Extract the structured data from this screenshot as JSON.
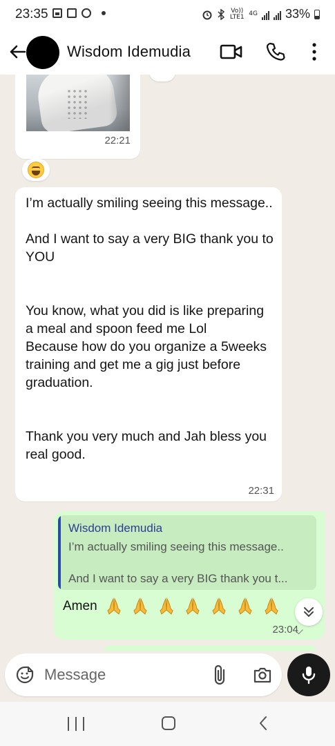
{
  "status_bar": {
    "time": "23:35",
    "network_volte": "Vo)) LTE1",
    "network_4g": "4G",
    "battery": "33%"
  },
  "header": {
    "contact_name": "Wisdom Idemudia"
  },
  "messages": [
    {
      "type": "image",
      "direction": "incoming",
      "time": "22:21",
      "reaction": "laughing-face-emoji"
    },
    {
      "type": "text",
      "direction": "incoming",
      "text": "I’m actually smiling seeing this message..\n\nAnd I want to say a very BIG thank you to YOU\n\n\nYou know, what you did is like preparing a meal and spoon feed me Lol\nBecause how do you organize a 5weeks training and get me a gig just before graduation.\n\n\nThank you very much and Jah bless you real good.",
      "time": "22:31"
    },
    {
      "type": "reply",
      "direction": "outgoing",
      "quoted_author": "Wisdom Idemudia",
      "quoted_line1": "I’m actually smiling seeing this message..",
      "quoted_line2": "And I want to say a very BIG thank you t...",
      "text": "Amen",
      "emoji_count": 7,
      "emoji": "folded-hands-emoji",
      "time": "23:04"
    }
  ],
  "composer": {
    "placeholder": "Message"
  },
  "colors": {
    "chat_background": "#f1ede6",
    "incoming_bubble": "#ffffff",
    "outgoing_bubble": "#d9fdd3",
    "quote_bar": "#2b4aa8"
  }
}
